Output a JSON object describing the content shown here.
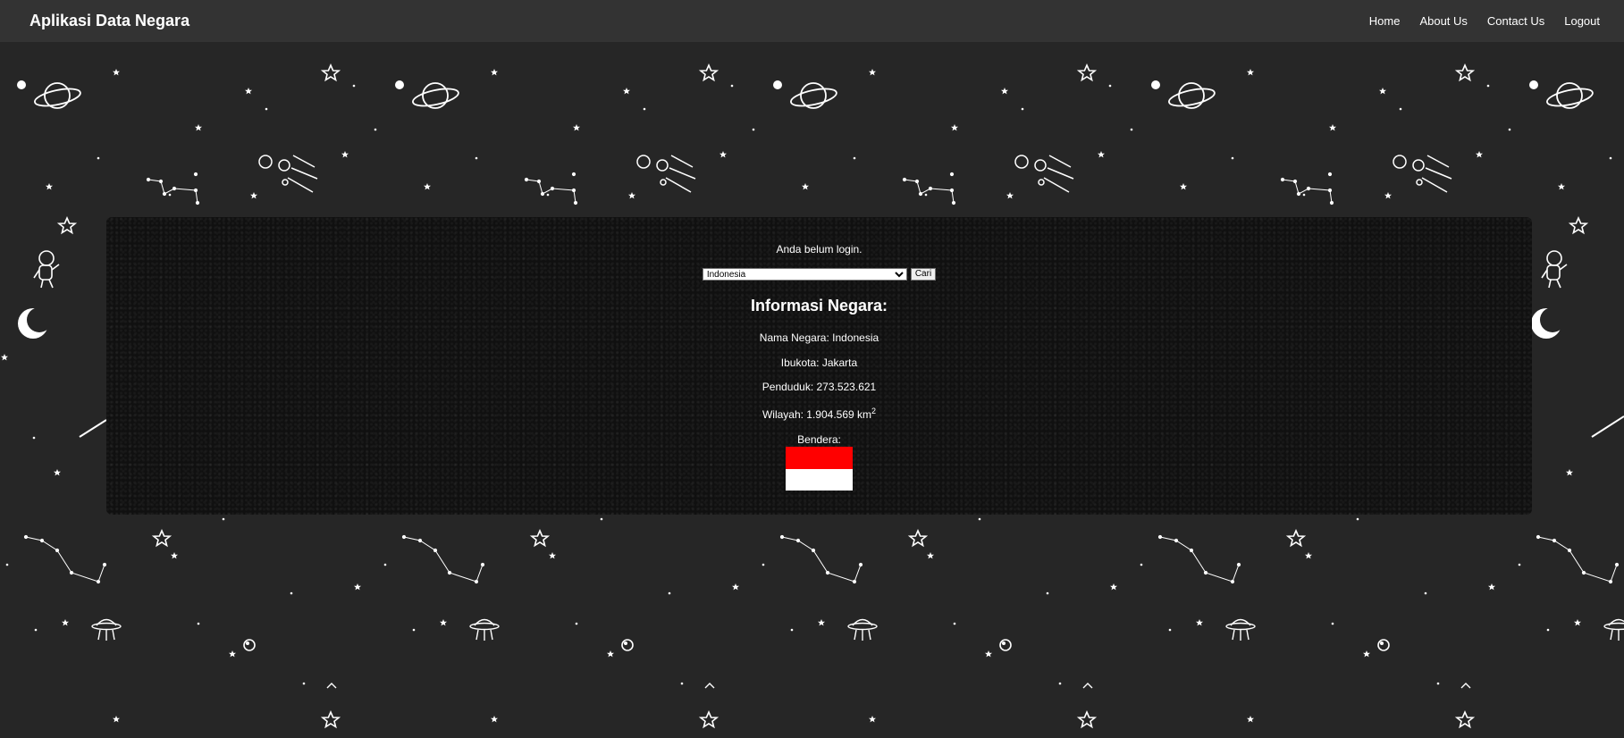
{
  "navbar": {
    "brand": "Aplikasi Data Negara",
    "links": [
      "Home",
      "About Us",
      "Contact Us",
      "Logout"
    ]
  },
  "panel": {
    "status": "Anda belum login.",
    "search": {
      "selected_country": "Indonesia",
      "button_label": "Cari"
    },
    "info": {
      "title": "Informasi Negara:",
      "name_line": "Nama Negara: Indonesia",
      "capital_line": "Ibukota: Jakarta",
      "population_line": "Penduduk: 273.523.621",
      "area_prefix": "Wilayah: 1.904.569 km",
      "area_sup": "2",
      "flag_label": "Bendera:"
    },
    "flag_colors": {
      "top": "#ff0000",
      "bottom": "#ffffff"
    }
  },
  "theme": {
    "navbar_bg": "#333333",
    "page_bg": "#262626",
    "panel_bg": "#101010"
  },
  "background_icons": [
    "planet-icon",
    "star-icon",
    "comet-icon",
    "constellation-icon",
    "astronaut-icon",
    "moon-icon",
    "ufo-icon"
  ]
}
